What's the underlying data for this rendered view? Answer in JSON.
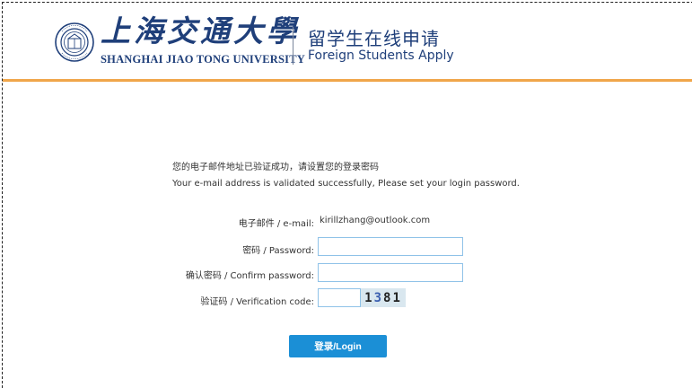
{
  "header": {
    "logo_cn": "上海交通大學",
    "logo_en": "SHANGHAI JIAO TONG UNIVERSITY",
    "subtitle_cn": "留学生在线申请",
    "subtitle_en": "Foreign Students Apply",
    "accent_color": "#f0a64a",
    "brand_color": "#1f3f7a"
  },
  "message": {
    "cn": "您的电子邮件地址已验证成功，请设置您的登录密码",
    "en": "Your e-mail address is validated successfully, Please set your login password."
  },
  "form": {
    "email_label": "电子邮件 / e-mail:",
    "email_value": "kirillzhang@outlook.com",
    "password_label": "密码 / Password:",
    "password_value": "",
    "confirm_label": "确认密码 / Confirm password:",
    "confirm_value": "",
    "captcha_label": "验证码 / Verification code:",
    "captcha_value": "",
    "captcha_digits": [
      "1",
      "3",
      "8",
      "1"
    ],
    "submit_label": "登录/Login",
    "button_color": "#1b8fd6"
  }
}
